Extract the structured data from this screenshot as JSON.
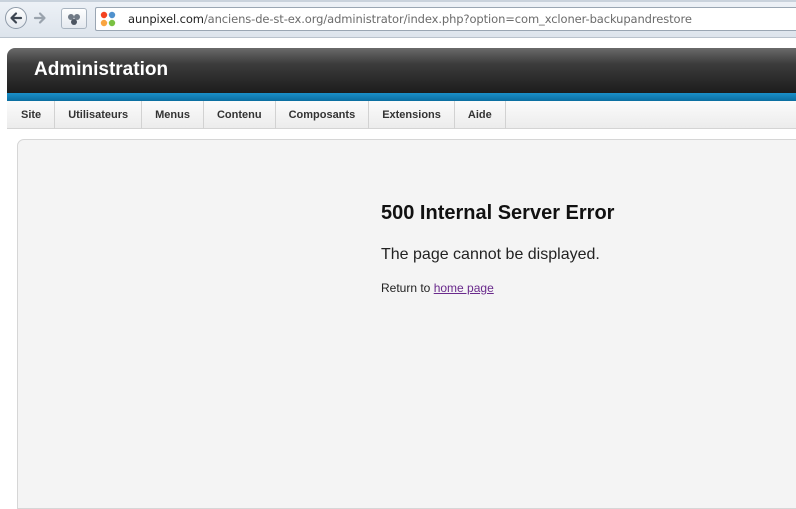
{
  "browser": {
    "url_host": "aunpixel.com",
    "url_path": "/anciens-de-st-ex.org/administrator/index.php?option=com_xcloner-backupandrestore",
    "icons": [
      "back-arrow-icon",
      "forward-arrow-icon",
      "extension-icon",
      "joomla-favicon-icon"
    ]
  },
  "header": {
    "title": "Administration",
    "accent_color": "#1a8fc9"
  },
  "menu": {
    "items": [
      {
        "label": "Site"
      },
      {
        "label": "Utilisateurs"
      },
      {
        "label": "Menus"
      },
      {
        "label": "Contenu"
      },
      {
        "label": "Composants"
      },
      {
        "label": "Extensions"
      },
      {
        "label": "Aide"
      }
    ]
  },
  "error": {
    "title": "500 Internal Server Error",
    "message": "The page cannot be displayed.",
    "return_prefix": "Return to",
    "return_link": "home page"
  }
}
